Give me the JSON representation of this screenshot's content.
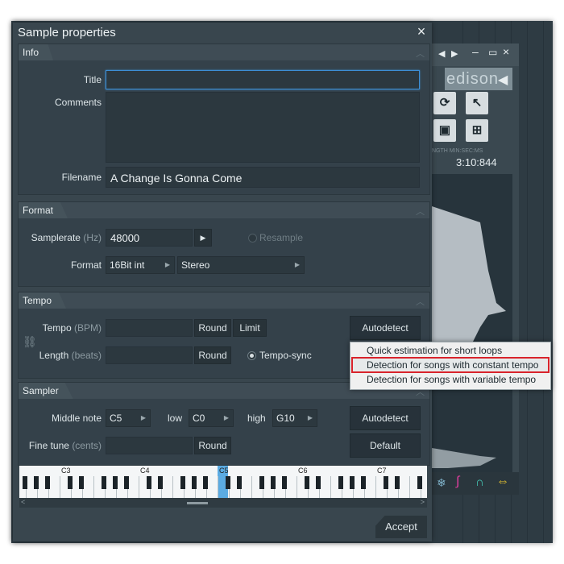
{
  "background_app": {
    "edison_logo": "edison",
    "time_labels": "NGTH   MIN:SEC:MS",
    "time_value": "3:10:844"
  },
  "dialog": {
    "title": "Sample properties",
    "close_icon": "×",
    "info": {
      "header": "Info",
      "title_label": "Title",
      "title_value": "",
      "comments_label": "Comments",
      "filename_label": "Filename",
      "filename_value": "A Change Is Gonna Come"
    },
    "format": {
      "header": "Format",
      "samplerate_label": "Samplerate",
      "samplerate_unit": "(Hz)",
      "samplerate_value": "48000",
      "resample_label": "Resample",
      "format_label": "Format",
      "bit_depth": "16Bit int",
      "channels": "Stereo"
    },
    "tempo": {
      "header": "Tempo",
      "tempo_label": "Tempo",
      "tempo_unit": "(BPM)",
      "round_label": "Round",
      "limit_label": "Limit",
      "autodetect_label": "Autodetect",
      "length_label": "Length",
      "length_unit": "(beats)",
      "round2_label": "Round",
      "tempo_sync_label": "Tempo-sync"
    },
    "sampler": {
      "header": "Sampler",
      "middle_note_label": "Middle note",
      "middle_note_value": "C5",
      "low_label": "low",
      "low_value": "C0",
      "high_label": "high",
      "high_value": "G10",
      "autodetect_label": "Autodetect",
      "fine_tune_label": "Fine tune",
      "fine_tune_unit": "(cents)",
      "round_label": "Round",
      "default_label": "Default"
    },
    "piano": {
      "octaves": [
        "C3",
        "C4",
        "C5",
        "C6",
        "C7"
      ],
      "selected_note": "C5",
      "highlight_color": "#4aa3df"
    },
    "accept_label": "Accept"
  },
  "autodetect_menu": {
    "items": [
      "Quick estimation for short loops",
      "Detection for songs with constant tempo",
      "Detection for songs with variable tempo"
    ],
    "highlighted_index": 1,
    "highlight_color": "#d9232b"
  },
  "icons": [
    "close-icon",
    "link-icon",
    "play-arrow-icon",
    "chevron-up-icon",
    "speaker-icon",
    "loop-icon",
    "cursor-icon",
    "save-icon",
    "fit-icon"
  ]
}
